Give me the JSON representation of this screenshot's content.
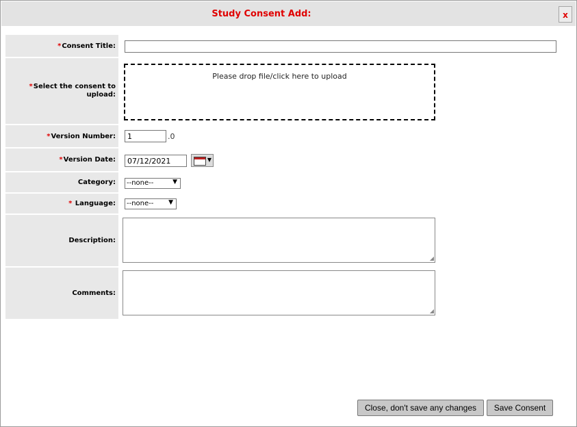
{
  "dialog": {
    "title": "Study Consent Add:",
    "close_label": "x"
  },
  "form": {
    "consent_title": {
      "label": "Consent Title:",
      "value": ""
    },
    "upload": {
      "label": "Select the consent to upload:",
      "drop_text": "Please drop file/click here to upload"
    },
    "version_number": {
      "label": "Version Number:",
      "value": "1",
      "suffix": ".0"
    },
    "version_date": {
      "label": "Version Date:",
      "value": "07/12/2021"
    },
    "category": {
      "label": "Category:",
      "selected": "--none--"
    },
    "language": {
      "label": "Language:",
      "selected": "--none--"
    },
    "description": {
      "label": "Description:",
      "value": ""
    },
    "comments": {
      "label": "Comments:",
      "value": ""
    },
    "required_mark": "*"
  },
  "buttons": {
    "close": "Close, don't save any changes",
    "save": "Save Consent"
  },
  "colors": {
    "accent_red": "#e00000",
    "label_bg": "#e8e8e8",
    "titlebar_bg": "#e3e3e3"
  }
}
